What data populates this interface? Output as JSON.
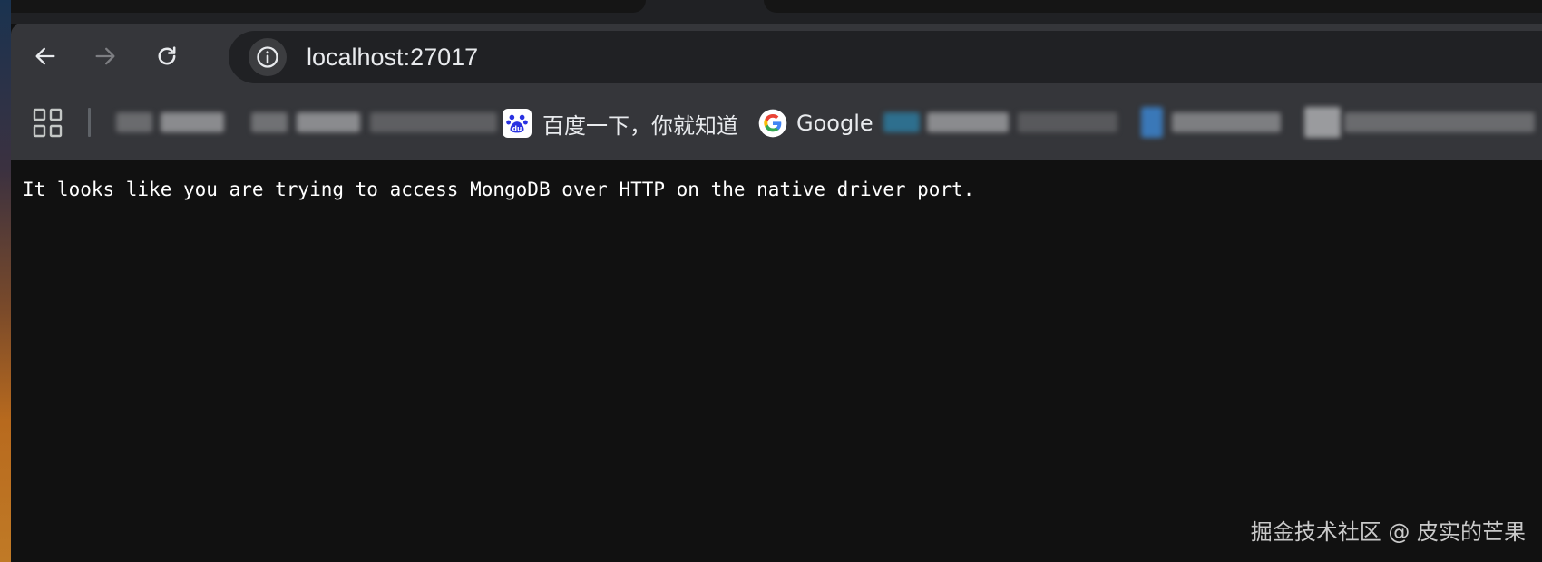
{
  "browser": {
    "url": "localhost:27017",
    "nav": {
      "back_icon": "arrow-left-icon",
      "forward_icon": "arrow-right-icon",
      "reload_icon": "reload-icon",
      "info_icon": "info-icon"
    }
  },
  "bookmarks": {
    "apps_icon": "apps-grid-icon",
    "items": [
      {
        "label": "百度一下，你就知道",
        "icon": "baidu-icon"
      },
      {
        "label": "Google",
        "icon": "google-icon"
      }
    ]
  },
  "page": {
    "message": "It looks like you are trying to access MongoDB over HTTP on the native driver port."
  },
  "watermark": {
    "text": "掘金技术社区 @ 皮实的芒果"
  },
  "colors": {
    "toolbar": "#35363a",
    "omnibox": "#202124",
    "page_bg": "#111111",
    "text": "#ffffff"
  }
}
